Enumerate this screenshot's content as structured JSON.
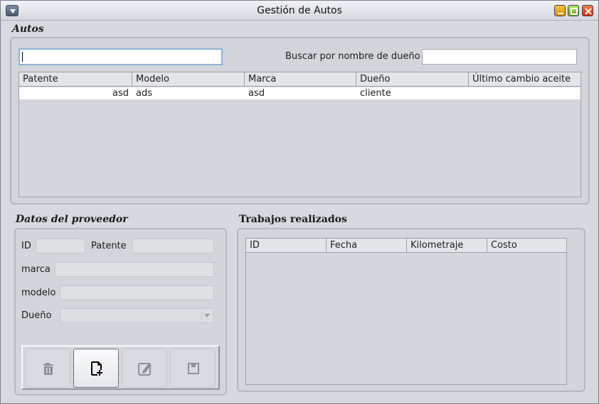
{
  "window": {
    "title": "Gestión de Autos",
    "buttons": [
      "menu-icon",
      "minimize-icon",
      "maximize-icon",
      "close-icon"
    ]
  },
  "autos": {
    "section_title": "Autos",
    "filter_input_value": "",
    "search_label": "Buscar por nombre de dueño",
    "search_value": "",
    "columns": [
      "Patente",
      "Modelo",
      "Marca",
      "Dueño",
      "Último cambio aceite"
    ],
    "rows": [
      {
        "patente": "asd",
        "modelo": "ads",
        "marca": "asd",
        "dueno": "cliente",
        "ultimo_cambio": ""
      }
    ]
  },
  "proveedor": {
    "section_title": "Datos del proveedor",
    "id_label": "ID",
    "id_value": "",
    "patente_label": "Patente",
    "patente_value": "",
    "marca_label": "marca",
    "marca_value": "",
    "modelo_label": "modelo",
    "modelo_value": "",
    "dueno_label": "Dueño",
    "dueno_value": "",
    "toolbar_icons": [
      "trash-icon",
      "new-document-icon",
      "edit-icon",
      "save-icon"
    ]
  },
  "trabajos": {
    "section_title": "Trabajos realizados",
    "columns": [
      "ID",
      "Fecha",
      "Kilometraje",
      "Costo"
    ],
    "rows": []
  },
  "colors": {
    "background": "#d7d9de",
    "row_selected": "#ffffff",
    "focus_border": "#8fb2d6",
    "close_button": "#e0411a",
    "minimize_button": "#f0a21c",
    "maximize_button": "#8cc63f"
  }
}
